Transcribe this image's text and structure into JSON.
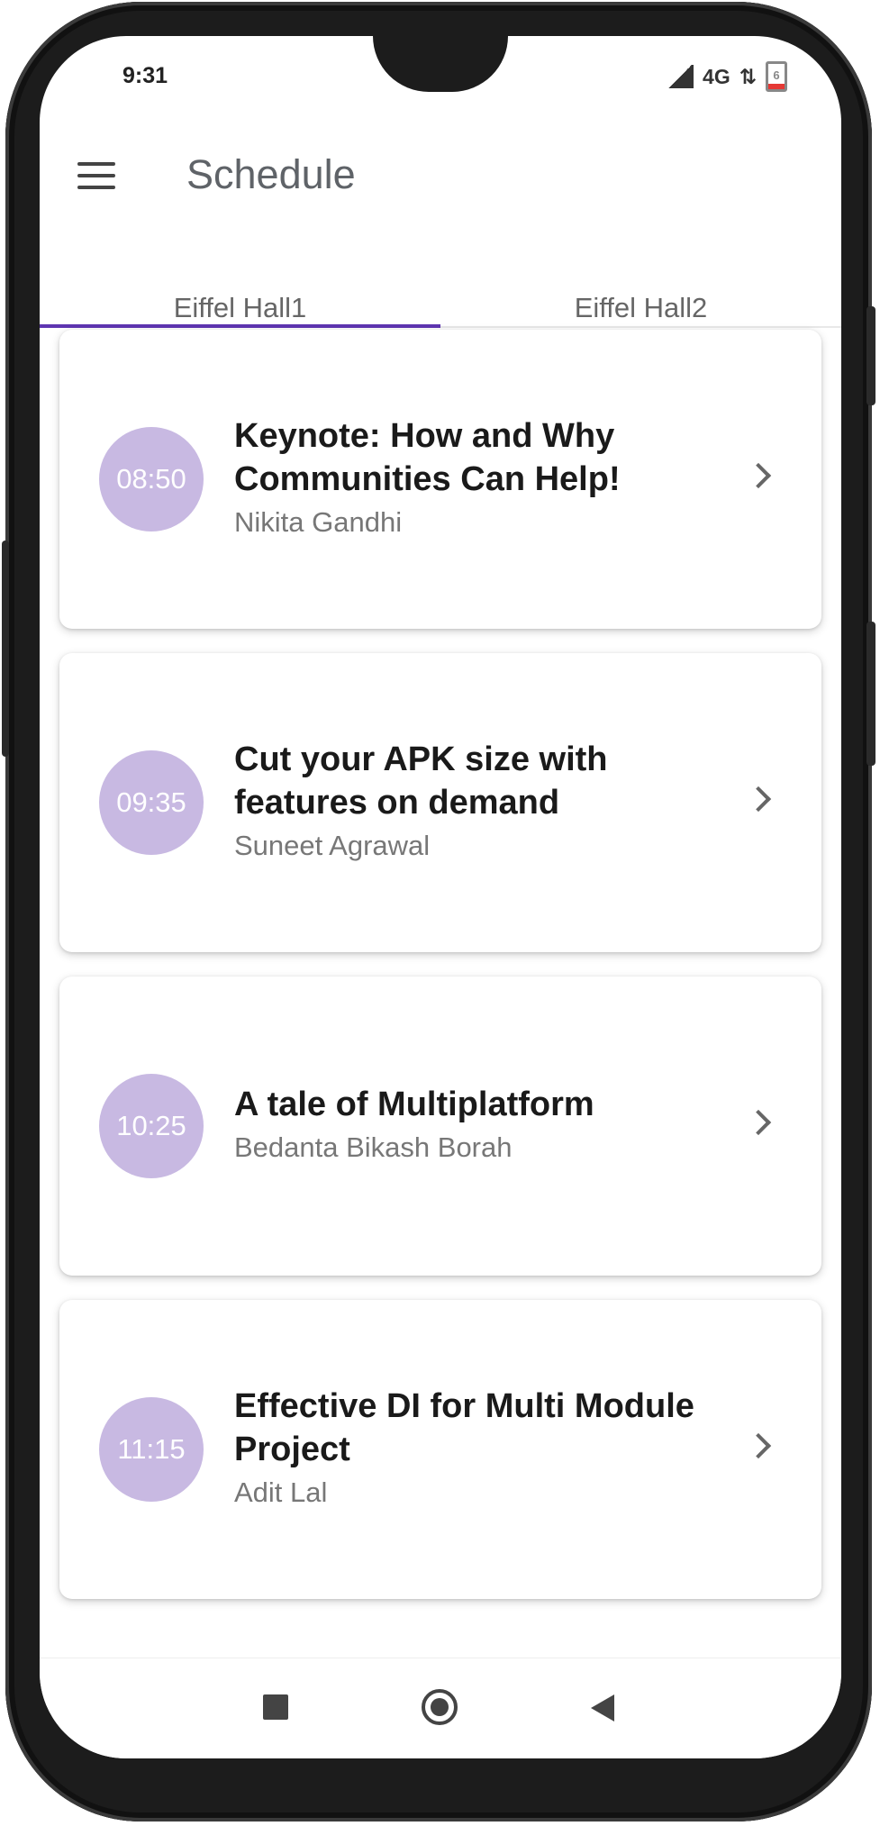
{
  "status_bar": {
    "time": "9:31",
    "network": "4G",
    "battery_level": "6"
  },
  "app_bar": {
    "title": "Schedule"
  },
  "tabs": [
    {
      "label": "Eiffel Hall1",
      "active": true
    },
    {
      "label": "Eiffel Hall2",
      "active": false
    }
  ],
  "sessions": [
    {
      "time": "08:50",
      "title_lines": [
        "Keynote: How and Why",
        "Communities Can Help!"
      ],
      "speaker": "Nikita Gandhi"
    },
    {
      "time": "09:35",
      "title_lines": [
        "Cut your APK size with",
        "features on demand"
      ],
      "speaker": "Suneet Agrawal"
    },
    {
      "time": "10:25",
      "title_lines": [
        "A tale of Multiplatform"
      ],
      "speaker": "Bedanta Bikash Borah"
    },
    {
      "time": "11:15",
      "title_lines": [
        "Effective DI for Multi Module",
        "Project"
      ],
      "speaker": "Adit Lal"
    }
  ],
  "colors": {
    "accent": "#5e35b1",
    "time_bubble": "#c8b9e2"
  }
}
